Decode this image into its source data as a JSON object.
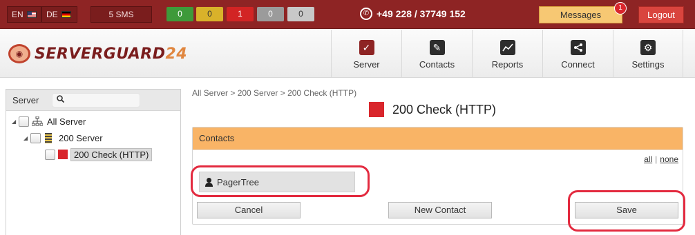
{
  "topbar": {
    "languages": [
      {
        "code": "EN",
        "flag": "us-flag"
      },
      {
        "code": "DE",
        "flag": "de-flag"
      }
    ],
    "sms": "5 SMS",
    "counters": [
      {
        "value": "0",
        "color": "#3e9a3a"
      },
      {
        "value": "0",
        "color": "#d9b22a"
      },
      {
        "value": "1",
        "color": "#d22424"
      },
      {
        "value": "0",
        "color": "#9b9b9b"
      },
      {
        "value": "0",
        "color": "#c8c8c8"
      }
    ],
    "phone": "+49 228 / 37749 152",
    "messages_label": "Messages",
    "messages_badge": "1",
    "logout_label": "Logout"
  },
  "header": {
    "logo_text": "SERVERGUARD",
    "logo_num": "24",
    "nav": [
      {
        "label": "Server",
        "icon": "check-icon",
        "active": true
      },
      {
        "label": "Contacts",
        "icon": "pen-icon",
        "active": false
      },
      {
        "label": "Reports",
        "icon": "chart-icon",
        "active": false
      },
      {
        "label": "Connect",
        "icon": "share-icon",
        "active": false
      },
      {
        "label": "Settings",
        "icon": "gear-icon",
        "active": false
      }
    ]
  },
  "tree": {
    "title": "Server",
    "search_placeholder": "",
    "nodes": [
      {
        "label": "All Server",
        "level": 0
      },
      {
        "label": "200 Server",
        "level": 1
      },
      {
        "label": "200 Check (HTTP)",
        "level": 2,
        "selected": true
      }
    ]
  },
  "main": {
    "breadcrumb": "All Server > 200 Server > 200 Check (HTTP)",
    "title": "200 Check (HTTP)",
    "status_color": "#d9262c",
    "panel_title": "Contacts",
    "link_all": "all",
    "link_separator": "|",
    "link_none": "none",
    "contacts": [
      "PagerTree"
    ],
    "buttons": {
      "cancel": "Cancel",
      "new_contact": "New Contact",
      "save": "Save"
    }
  }
}
